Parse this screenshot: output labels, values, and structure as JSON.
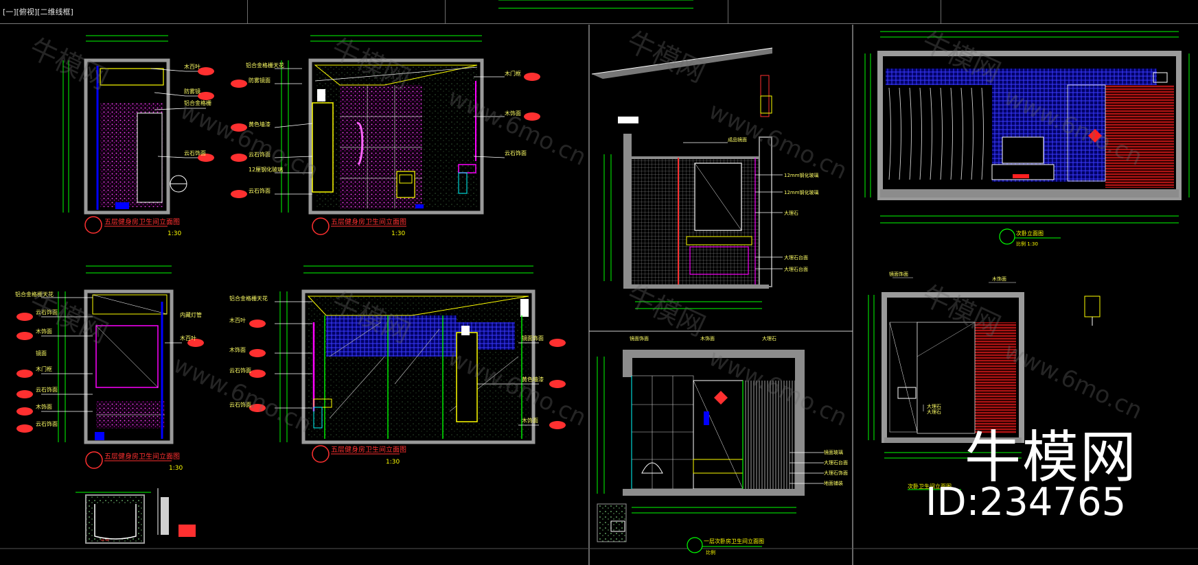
{
  "viewport": {
    "label": "[一][俯视][二维线框]"
  },
  "drawings": [
    {
      "title": "五层健身房卫生间立面图",
      "scale": "1:30"
    },
    {
      "title": "五层健身房卫生间立面图",
      "scale": "1:30"
    },
    {
      "title": "五层健身房卫生间立面图",
      "scale": "1:30"
    },
    {
      "title": "五层健身房卫生间立面图",
      "scale": "1:30"
    },
    {
      "title": "次卧立面图",
      "scale": "比例 1:30"
    },
    {
      "title": "次卧卫生间立面图",
      "scale": ""
    },
    {
      "title": "一层次卧房卫生间立面图",
      "scale": "比例"
    }
  ],
  "watermark": {
    "brand": "牛模网",
    "domain": "www.6mo.cn"
  },
  "brand": {
    "name": "牛模网",
    "id": "ID:234765"
  },
  "colors": {
    "background": "#000000",
    "line_yellow": "#ffff00",
    "line_green": "#00ff00",
    "line_cyan": "#00ffff",
    "line_magenta": "#ff00ff",
    "line_red": "#ff0000",
    "line_blue": "#0000ff",
    "wall_gray": "#8c8c8c"
  }
}
